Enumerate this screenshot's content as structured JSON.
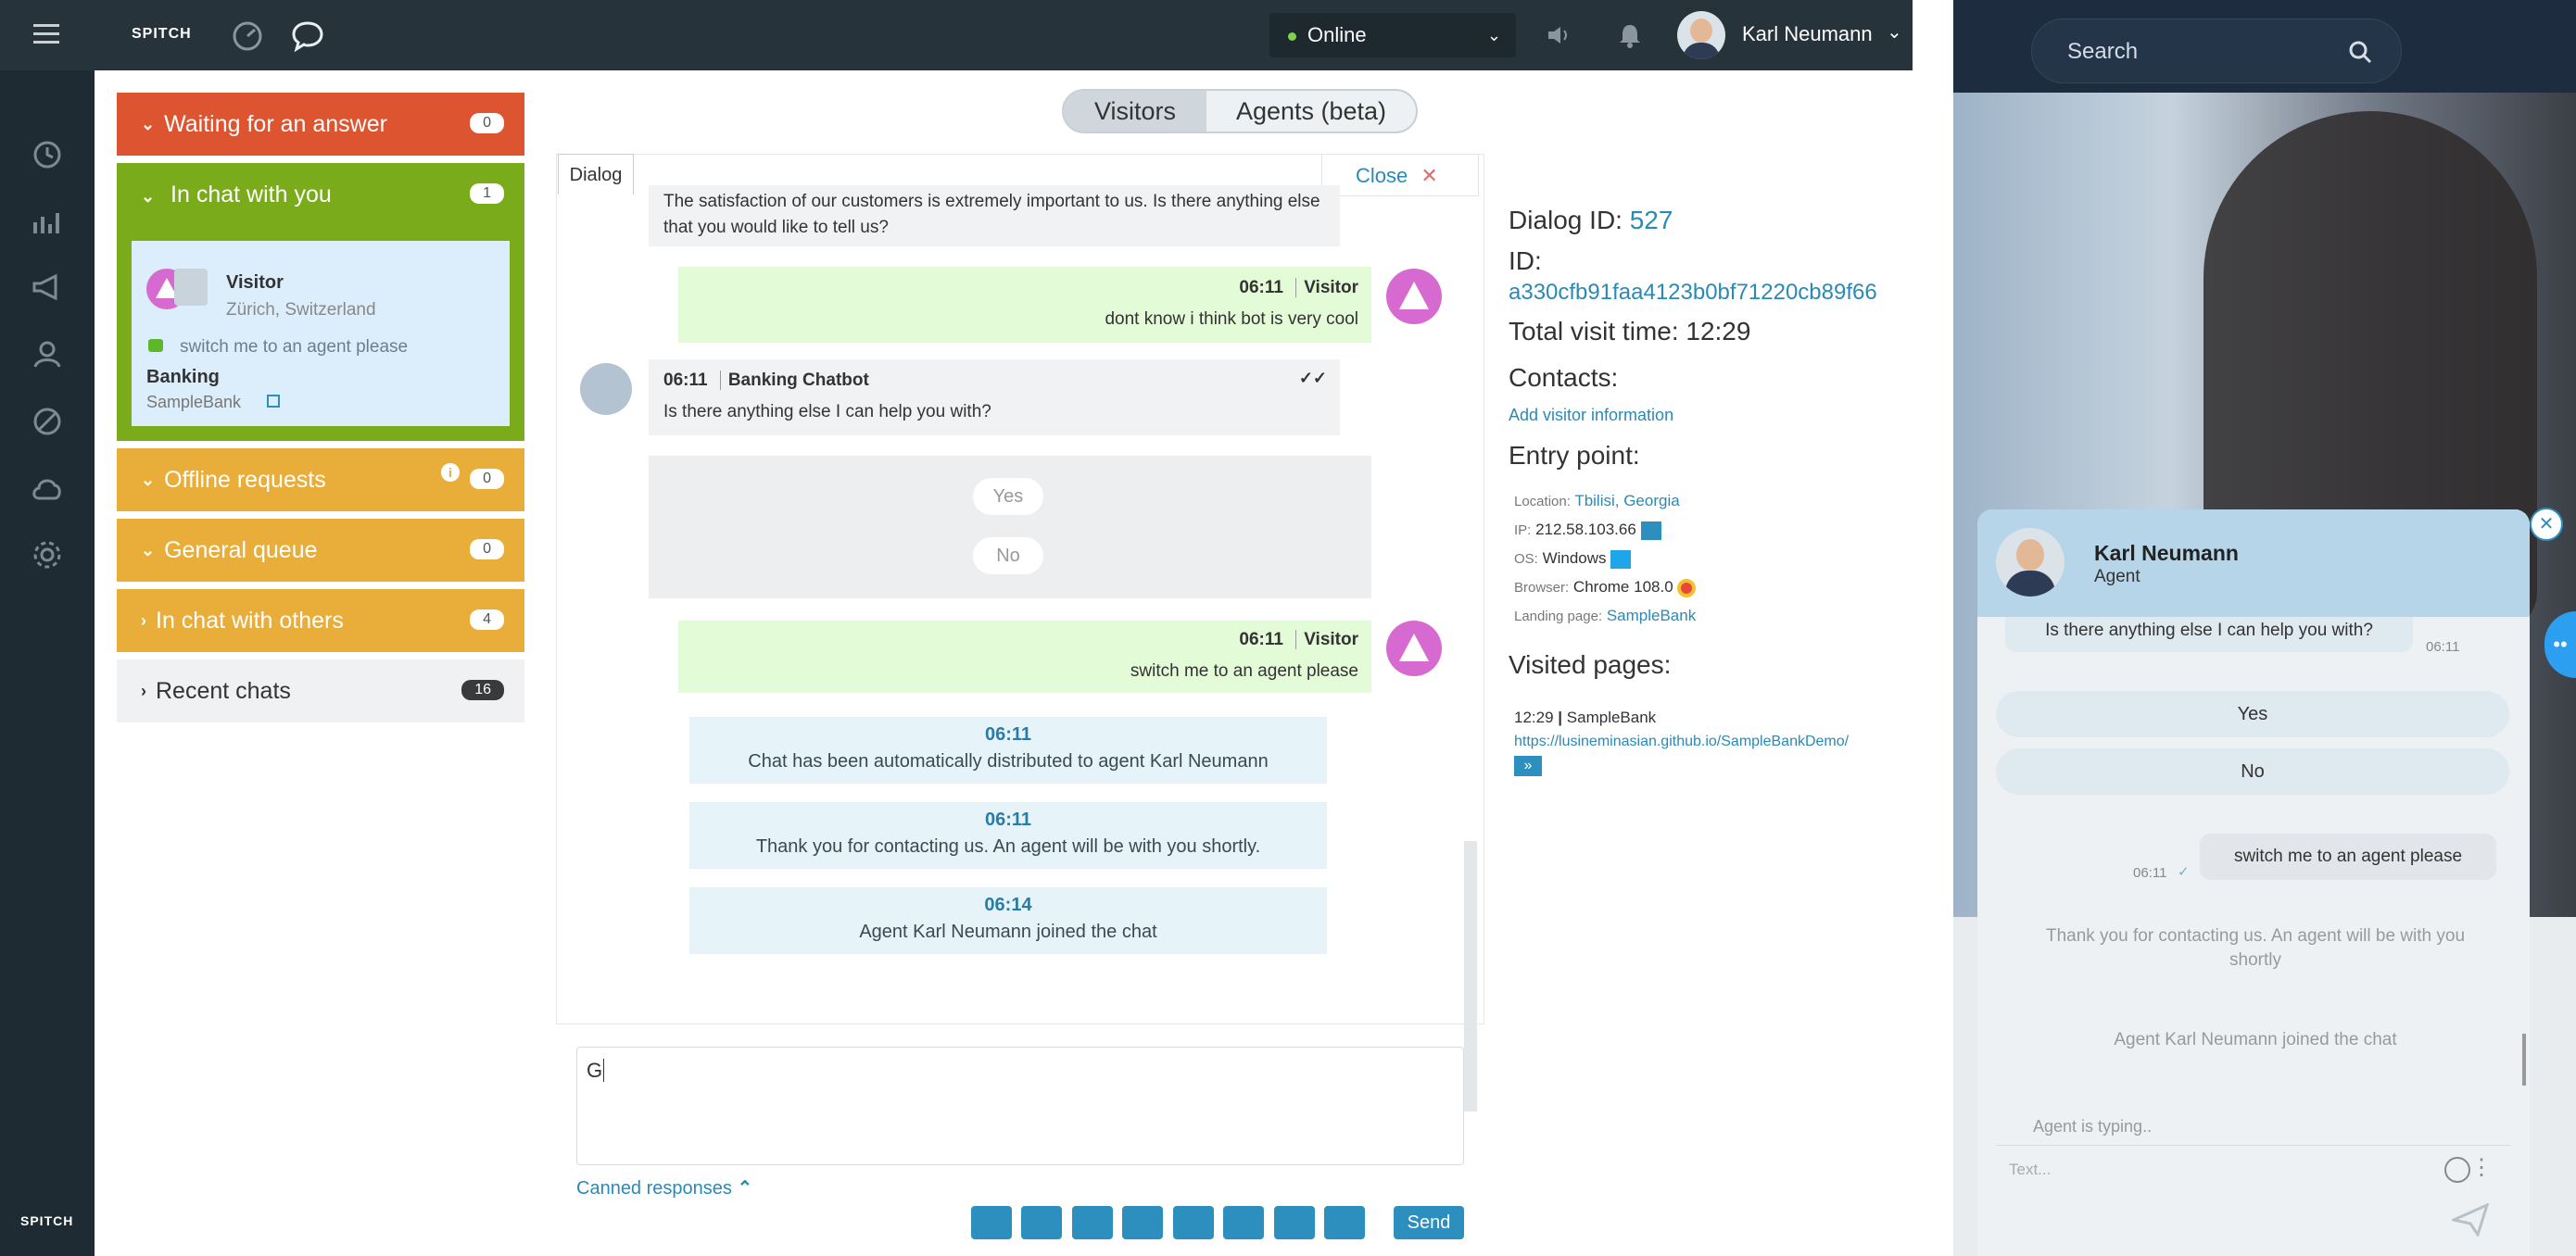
{
  "topbar": {
    "logo": "SPITCH",
    "status": "Online",
    "user_name": "Karl Neumann"
  },
  "rail": {
    "bottom_logo": "SPITCH"
  },
  "queues": [
    {
      "label": "Waiting for an answer",
      "count": "0"
    },
    {
      "label": "In chat with you",
      "count": "1"
    },
    {
      "label": "Offline requests",
      "count": "0"
    },
    {
      "label": "General queue",
      "count": "0"
    },
    {
      "label": "In chat with others",
      "count": "4"
    },
    {
      "label": "Recent chats",
      "count": "16"
    }
  ],
  "active_chat": {
    "name": "Visitor",
    "location": "Zürich, Switzerland",
    "last_message": "switch me to an agent please",
    "bank_title": "Banking",
    "bank_site": "SampleBank"
  },
  "tabs": {
    "visitors": "Visitors",
    "agents": "Agents (beta)"
  },
  "dialog": {
    "tab_label": "Dialog",
    "close_label": "Close",
    "messages": {
      "m0": "The satisfaction of our customers is extremely important to us. Is there anything else that you would like to tell us?",
      "m1_time": "06:11",
      "m1_author": "Visitor",
      "m1_text": "dont know i think bot is very cool",
      "m2_time": "06:11",
      "m2_author": "Banking Chatbot",
      "m2_text": "Is there anything else I can help you with?",
      "opt_yes": "Yes",
      "opt_no": "No",
      "m3_time": "06:11",
      "m3_author": "Visitor",
      "m3_text": "switch me to an agent please",
      "s1_time": "06:11",
      "s1_text": "Chat has been automatically distributed to agent Karl Neumann",
      "s2_time": "06:11",
      "s2_text": "Thank you for contacting us. An agent will be with you shortly.",
      "s3_time": "06:14",
      "s3_text": "Agent Karl Neumann joined the chat"
    },
    "input_value": "G",
    "canned_label": "Canned responses",
    "send_label": "Send"
  },
  "info": {
    "dialog_id_label": "Dialog ID:",
    "dialog_id": "527",
    "id_label": "ID:",
    "id_value": "a330cfb91faa4123b0bf71220cb89f66",
    "visit_time": "Total visit time: 12:29",
    "contacts_label": "Contacts:",
    "add_visitor": "Add visitor information",
    "entry_label": "Entry point:",
    "location_label": "Location:",
    "location": "Tbilisi, Georgia",
    "ip_label": "IP:",
    "ip": "212.58.103.66",
    "os_label": "OS:",
    "os": "Windows",
    "browser_label": "Browser:",
    "browser": "Chrome 108.0",
    "landing_label": "Landing page:",
    "landing": "SampleBank",
    "visited_label": "Visited pages:",
    "visit_time_entry": "12:29",
    "visit_title": "SampleBank",
    "visit_url": "https://lusineminasian.github.io/SampleBankDemo/"
  },
  "right": {
    "search_placeholder": "Search"
  },
  "widget": {
    "agent_name": "Karl Neumann",
    "agent_role": "Agent",
    "bot_msg": "Is there anything else I can help you with?",
    "bot_time": "06:11",
    "yes": "Yes",
    "no": "No",
    "user_msg": "switch me to an agent please",
    "user_time": "06:11",
    "sys1": "Thank you for contacting us. An agent will be with you shortly",
    "sys2": "Agent Karl Neumann joined the chat",
    "typing": "Agent is typing..",
    "input_placeholder": "Text..."
  },
  "colors": {
    "waiting": "#dd5430",
    "in_chat_you": "#79ab1a",
    "orange_queue": "#e9ad3a",
    "accent_blue": "#2c8fbd",
    "visitor_bubble": "#e4fbd8"
  }
}
